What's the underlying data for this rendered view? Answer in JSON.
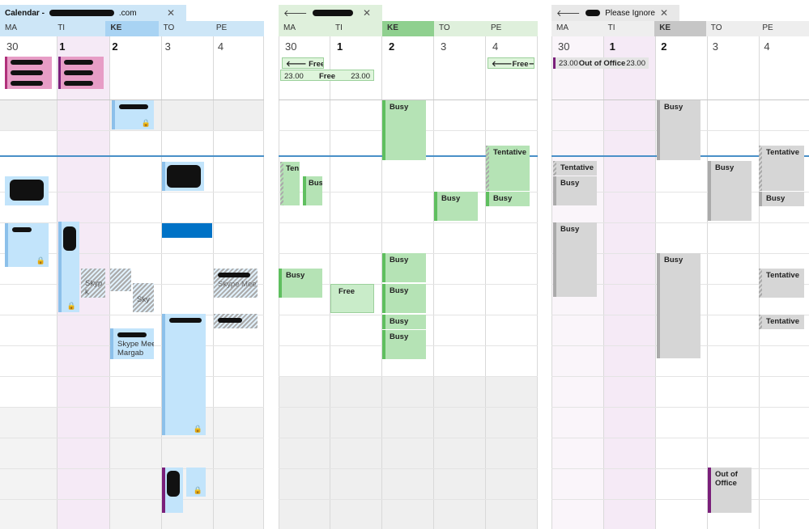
{
  "panes": [
    {
      "id": "mine",
      "tab_title": "Calendar - ",
      "tab_title_suffix": ".com",
      "days": [
        "MA",
        "TI",
        "KE",
        "TO",
        "PE"
      ],
      "dates": [
        "30",
        "1",
        "2",
        "3",
        "4"
      ],
      "colors": {
        "tab": "#cde6f7",
        "today": "#a8d3f3",
        "event": "#c2e4fb",
        "bar": "#8cc0ea",
        "accent": "#0072c6"
      },
      "events": {
        "blue_block_label": "",
        "skype_1": "Skyp",
        "skype_2": "k",
        "skype_3": "Sky",
        "skype_4": "Skype Mee",
        "skype_5": "Skype Mee",
        "skype_6": "Margab"
      }
    },
    {
      "id": "colleague",
      "tab_title": "",
      "days": [
        "MA",
        "TI",
        "KE",
        "TO",
        "PE"
      ],
      "dates": [
        "30",
        "1",
        "2",
        "3",
        "4"
      ],
      "colors": {
        "tab": "#dff0dc",
        "today": "#8fd08f",
        "event": "#b5e3b5",
        "bar": "#5fbf5f"
      },
      "allday": {
        "free_label": "Free",
        "time_start": "23.00",
        "time_end": "23.00",
        "free_label2": "Free",
        "free_label3": "Free"
      },
      "labels": {
        "busy": "Busy",
        "free": "Free",
        "tentative": "Tentative",
        "ten": "Ten",
        "bus": "Bus"
      }
    },
    {
      "id": "please-ignore",
      "tab_title": "Please Ignore",
      "days": [
        "MA",
        "TI",
        "KE",
        "TO",
        "PE"
      ],
      "dates": [
        "30",
        "1",
        "2",
        "3",
        "4"
      ],
      "colors": {
        "tab": "#e8e8e8",
        "today": "#c6c6c6",
        "event": "#d6d6d6",
        "bar": "#aaaaaa",
        "ooo": "#7a1f7a"
      },
      "allday": {
        "time_start": "23.00",
        "label": "Out of Office",
        "time_end": "23.00"
      },
      "labels": {
        "busy": "Busy",
        "tentative": "Tentative",
        "ooo_line1": "Out of",
        "ooo_line2": "Office"
      }
    }
  ]
}
